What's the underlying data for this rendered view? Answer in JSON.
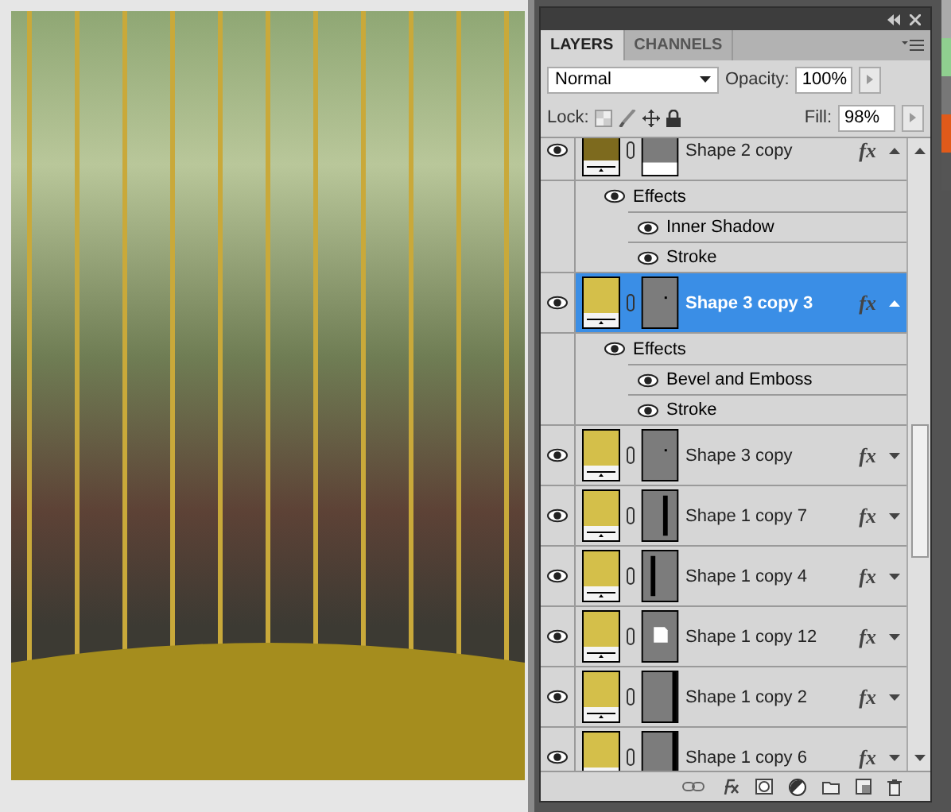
{
  "panel": {
    "tabs": [
      {
        "label": "LAYERS",
        "selected": true
      },
      {
        "label": "CHANNELS",
        "selected": false
      }
    ],
    "blend_mode": "Normal",
    "opacity_label": "Opacity:",
    "opacity": "100%",
    "lock_label": "Lock:",
    "fill_label": "Fill:",
    "fill": "98%"
  },
  "layers": [
    {
      "name": "Shape 2 copy",
      "color": "#7d6a1e",
      "kind": "blank",
      "visible": true,
      "selected": false,
      "fx": "fx",
      "expanded": true,
      "effects_label": "Effects",
      "effects": [
        {
          "name": "Inner Shadow",
          "visible": true
        },
        {
          "name": "Stroke",
          "visible": true
        }
      ]
    },
    {
      "name": "Shape 3 copy 3",
      "color": "#d4bf4a",
      "kind": "dot",
      "visible": true,
      "selected": true,
      "fx": "fx",
      "expanded": true,
      "effects_label": "Effects",
      "effects": [
        {
          "name": "Bevel and Emboss",
          "visible": true
        },
        {
          "name": "Stroke",
          "visible": true
        }
      ]
    },
    {
      "name": "Shape 3 copy",
      "color": "#d4bf4a",
      "kind": "dot",
      "visible": true,
      "selected": false,
      "fx": "fx",
      "expanded": false
    },
    {
      "name": "Shape 1 copy 7",
      "color": "#d4bf4a",
      "kind": "line-center",
      "visible": true,
      "selected": false,
      "fx": "fx",
      "expanded": false
    },
    {
      "name": "Shape 1 copy 4",
      "color": "#d4bf4a",
      "kind": "line-left",
      "visible": true,
      "selected": false,
      "fx": "fx",
      "expanded": false
    },
    {
      "name": "Shape 1 copy 12",
      "color": "#d4bf4a",
      "kind": "square",
      "visible": true,
      "selected": false,
      "fx": "fx",
      "expanded": false
    },
    {
      "name": "Shape 1 copy 2",
      "color": "#d4bf4a",
      "kind": "line-right",
      "visible": true,
      "selected": false,
      "fx": "fx",
      "expanded": false
    },
    {
      "name": "Shape 1 copy 6",
      "color": "#d4bf4a",
      "kind": "line-right",
      "visible": true,
      "selected": false,
      "fx": "fx",
      "expanded": false
    }
  ]
}
